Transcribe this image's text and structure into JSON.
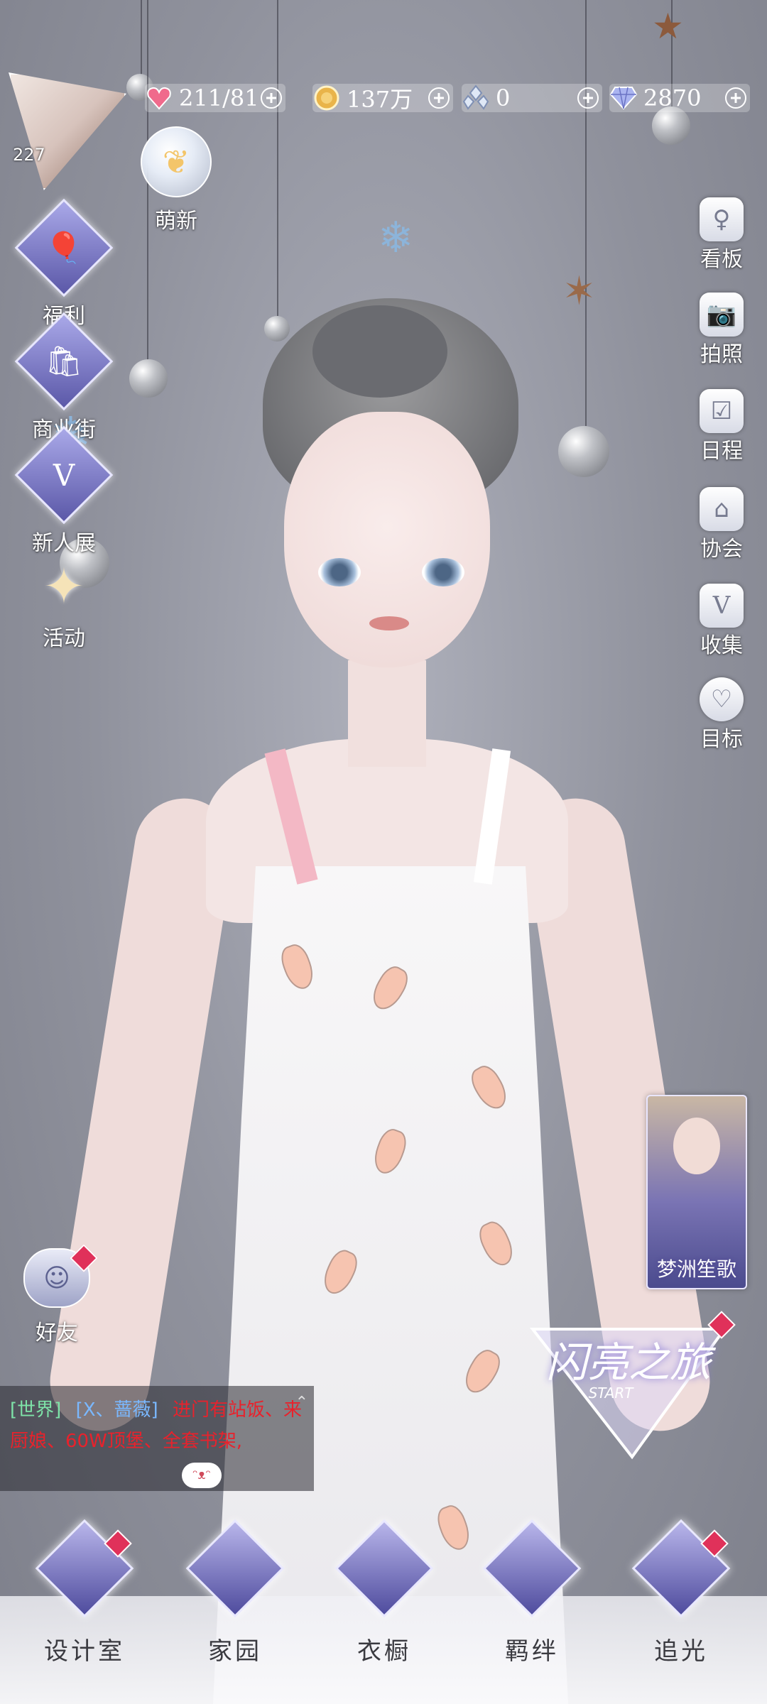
{
  "currencies": {
    "stamina": "211/81",
    "gold": "137万",
    "crystal": "0",
    "diamond": "2870"
  },
  "player": {
    "level": "227"
  },
  "top_event": {
    "label": "萌新"
  },
  "left_menu": [
    {
      "label": "福利",
      "icon": "balloon-icon"
    },
    {
      "label": "商业街",
      "icon": "shopping-bag-icon"
    },
    {
      "label": "新人展",
      "icon": "v-badge-icon"
    },
    {
      "label": "活动",
      "icon": "stars-icon"
    }
  ],
  "right_menu": [
    {
      "label": "看板",
      "icon": "dress-board-icon"
    },
    {
      "label": "拍照",
      "icon": "camera-icon"
    },
    {
      "label": "日程",
      "icon": "calendar-icon"
    },
    {
      "label": "协会",
      "icon": "building-icon"
    },
    {
      "label": "收集",
      "icon": "v-collection-icon"
    },
    {
      "label": "目标",
      "icon": "target-ribbon-icon"
    }
  ],
  "friends": {
    "label": "好友"
  },
  "promo_card": {
    "title": "梦洲笙歌"
  },
  "shine_journey": {
    "title": "闪亮之旅",
    "subtitle": "START"
  },
  "chat": {
    "channel": "[世界]",
    "user": "[X、蔷薇]",
    "message": "进门有站饭、来厨娘、60W顶堡、全套书架,"
  },
  "bottom_nav": [
    {
      "label": "设计室",
      "icon": "moon-icon"
    },
    {
      "label": "家园",
      "icon": "key-icon"
    },
    {
      "label": "衣橱",
      "icon": "snowflake-icon"
    },
    {
      "label": "羁绊",
      "icon": "clover-icon"
    },
    {
      "label": "追光",
      "icon": "butterfly-icon"
    }
  ],
  "colors": {
    "background": "#9a9ca7",
    "badge": "#e0315a",
    "chat_channel": "#7ee3a8",
    "chat_user": "#7ab8ff",
    "chat_message": "#e8222c"
  }
}
